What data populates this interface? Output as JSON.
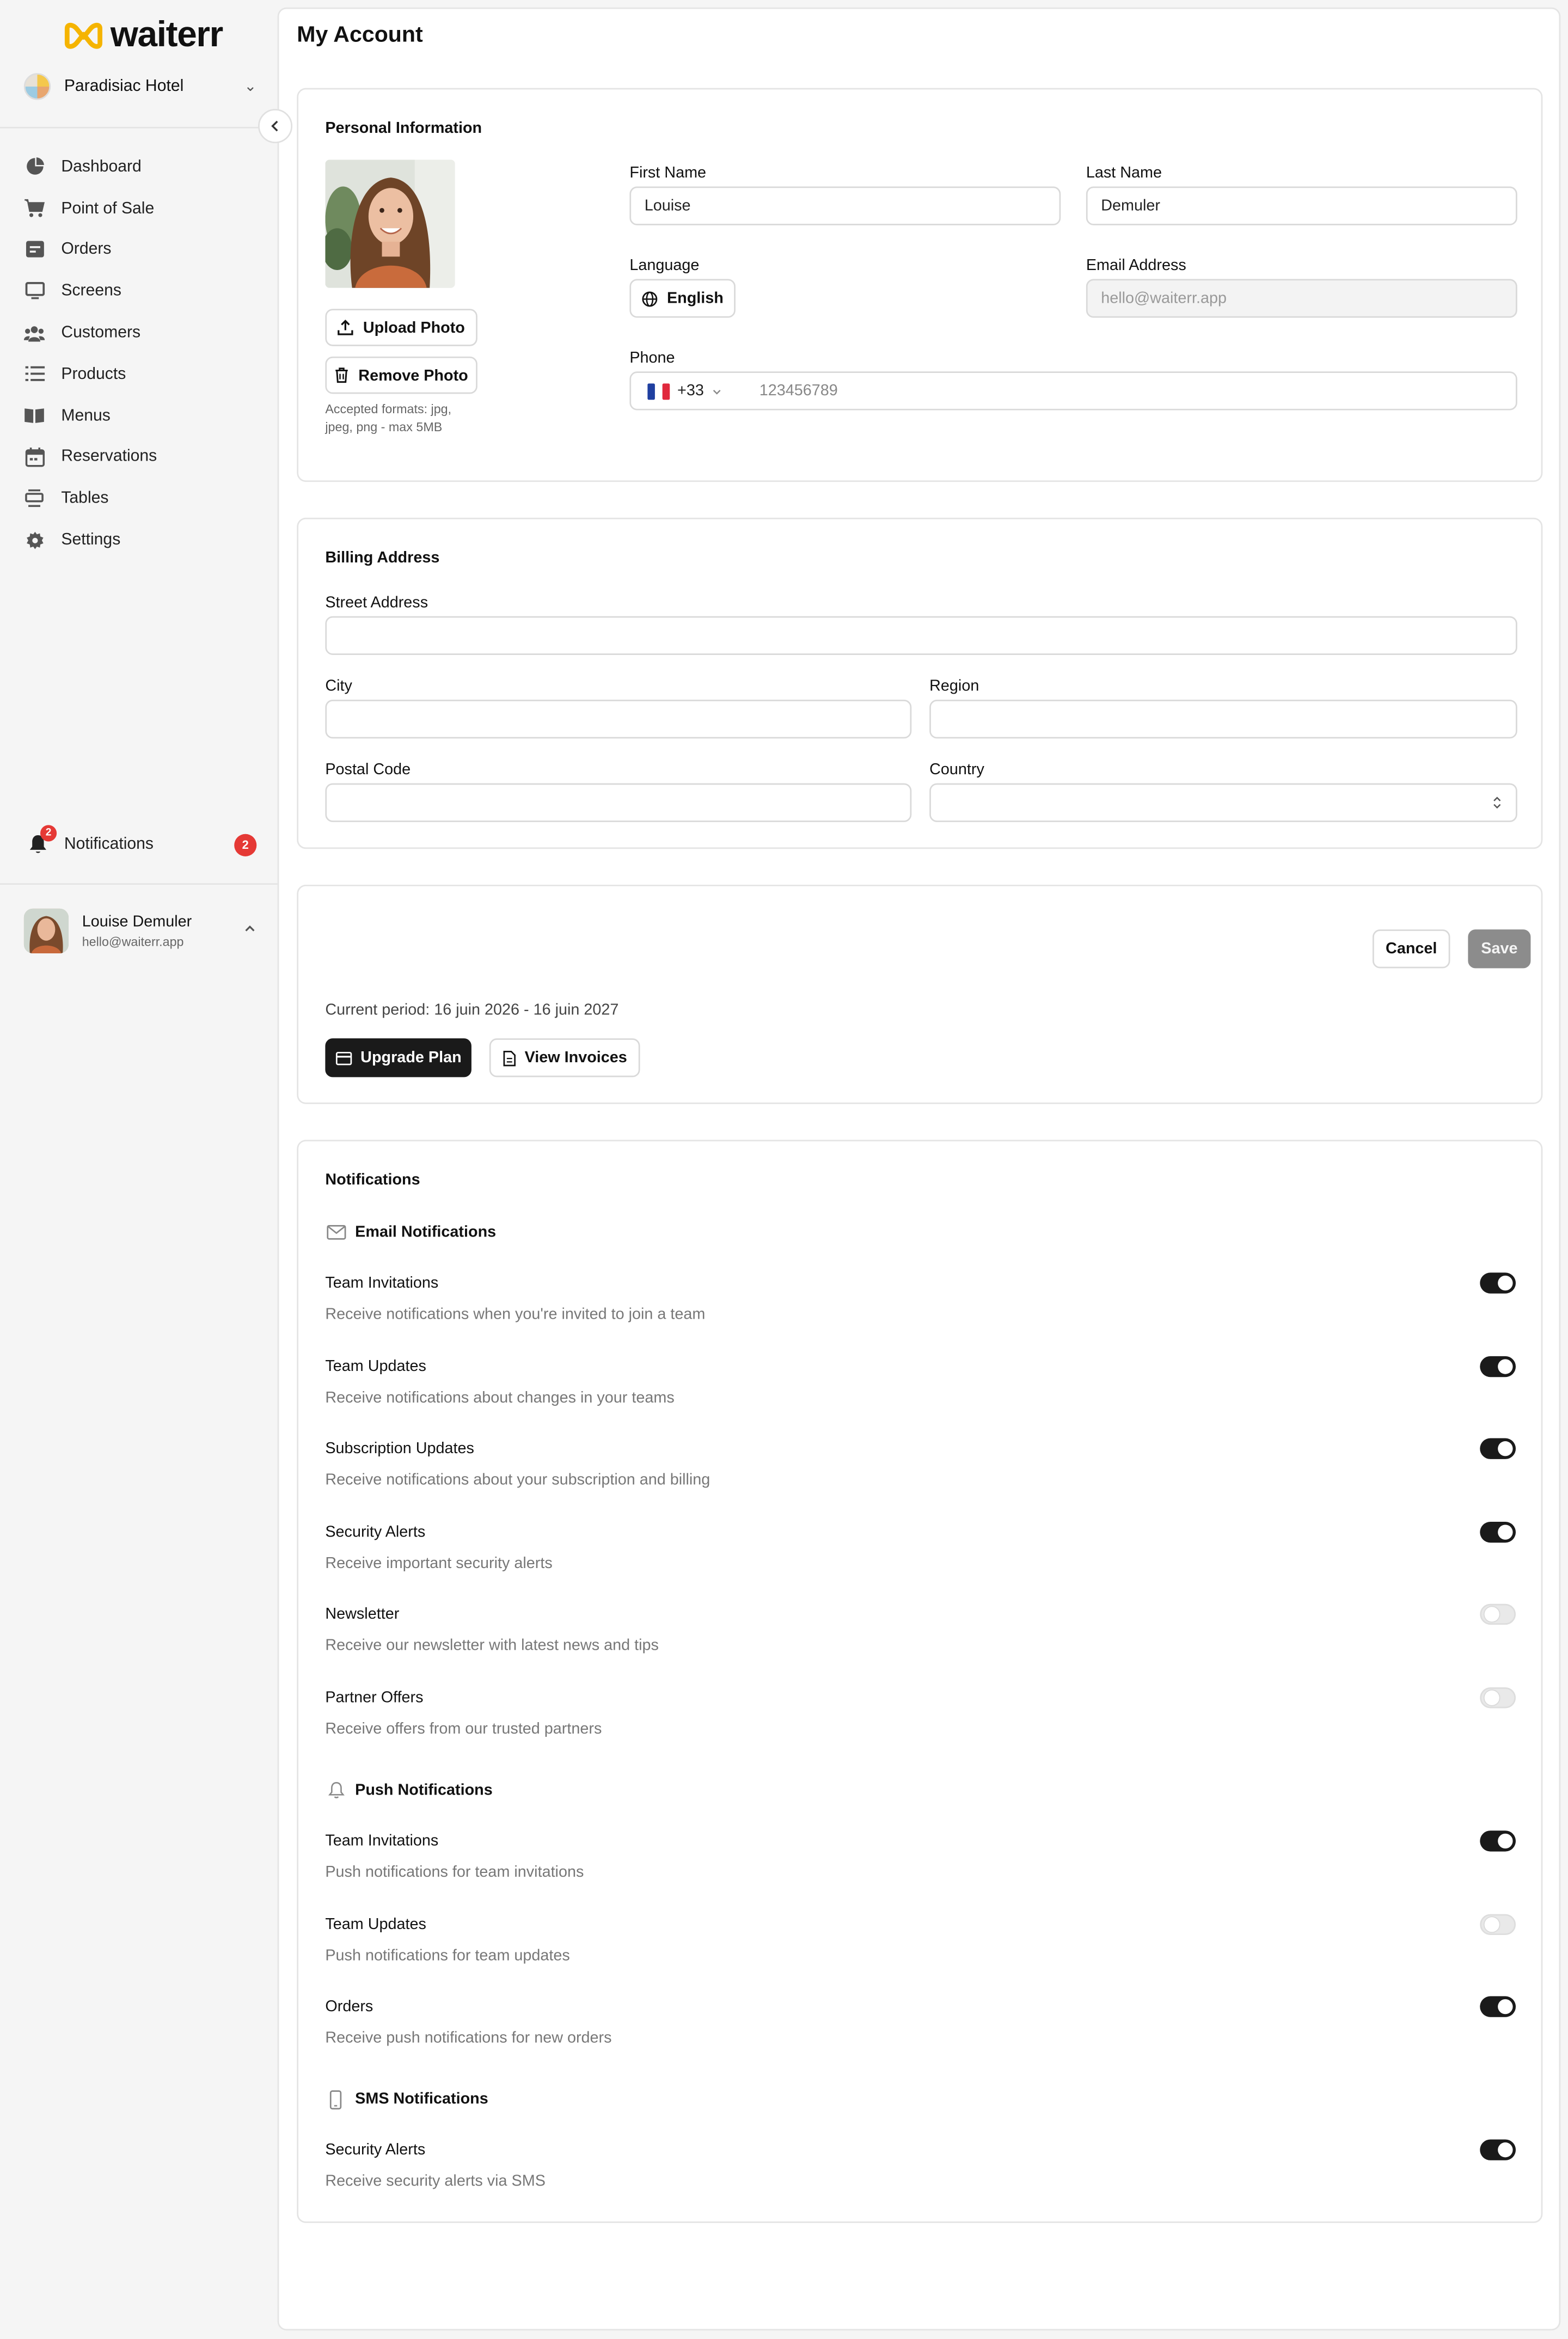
{
  "brand": {
    "name": "waiterr",
    "accent": "#f5b400"
  },
  "venue": {
    "name": "Paradisiac Hotel"
  },
  "nav": [
    {
      "label": "Dashboard",
      "icon": "pie-chart-icon"
    },
    {
      "label": "Point of Sale",
      "icon": "cart-icon"
    },
    {
      "label": "Orders",
      "icon": "orders-icon"
    },
    {
      "label": "Screens",
      "icon": "monitor-icon"
    },
    {
      "label": "Customers",
      "icon": "users-icon"
    },
    {
      "label": "Products",
      "icon": "list-icon"
    },
    {
      "label": "Menus",
      "icon": "book-icon"
    },
    {
      "label": "Reservations",
      "icon": "calendar-icon"
    },
    {
      "label": "Tables",
      "icon": "table-icon"
    },
    {
      "label": "Settings",
      "icon": "gear-icon"
    }
  ],
  "notifications": {
    "label": "Notifications",
    "count": "2"
  },
  "user": {
    "name": "Louise Demuler",
    "email": "hello@waiterr.app"
  },
  "page": {
    "title": "My Account"
  },
  "personal": {
    "title": "Personal Information",
    "upload_label": "Upload Photo",
    "remove_label": "Remove Photo",
    "hint": "Accepted formats: jpg, jpeg, png - max 5MB",
    "first_name_label": "First Name",
    "first_name": "Louise",
    "last_name_label": "Last Name",
    "last_name": "Demuler",
    "language_label": "Language",
    "language": "English",
    "email_label": "Email Address",
    "email": "hello@waiterr.app",
    "phone_label": "Phone",
    "phone_code": "+33",
    "phone_placeholder": "123456789"
  },
  "billing": {
    "title": "Billing Address",
    "street_label": "Street Address",
    "city_label": "City",
    "region_label": "Region",
    "postal_label": "Postal Code",
    "country_label": "Country"
  },
  "subscription": {
    "cancel_label": "Cancel",
    "save_label": "Save",
    "period": "Current period: 16 juin 2026 - 16 juin 2027",
    "upgrade_label": "Upgrade Plan",
    "invoices_label": "View Invoices"
  },
  "notif_settings": {
    "title": "Notifications",
    "email_head": "Email Notifications",
    "push_head": "Push Notifications",
    "sms_head": "SMS Notifications",
    "email": [
      {
        "title": "Team Invitations",
        "desc": "Receive notifications when you're invited to join a team",
        "on": true
      },
      {
        "title": "Team Updates",
        "desc": "Receive notifications about changes in your teams",
        "on": true
      },
      {
        "title": "Subscription Updates",
        "desc": "Receive notifications about your subscription and billing",
        "on": true
      },
      {
        "title": "Security Alerts",
        "desc": "Receive important security alerts",
        "on": true
      },
      {
        "title": "Newsletter",
        "desc": "Receive our newsletter with latest news and tips",
        "on": false
      },
      {
        "title": "Partner Offers",
        "desc": "Receive offers from our trusted partners",
        "on": false
      }
    ],
    "push": [
      {
        "title": "Team Invitations",
        "desc": "Push notifications for team invitations",
        "on": true
      },
      {
        "title": "Team Updates",
        "desc": "Push notifications for team updates",
        "on": false
      },
      {
        "title": "Orders",
        "desc": "Receive push notifications for new orders",
        "on": true
      }
    ],
    "sms": [
      {
        "title": "Security Alerts",
        "desc": "Receive security alerts via SMS",
        "on": true
      }
    ]
  }
}
